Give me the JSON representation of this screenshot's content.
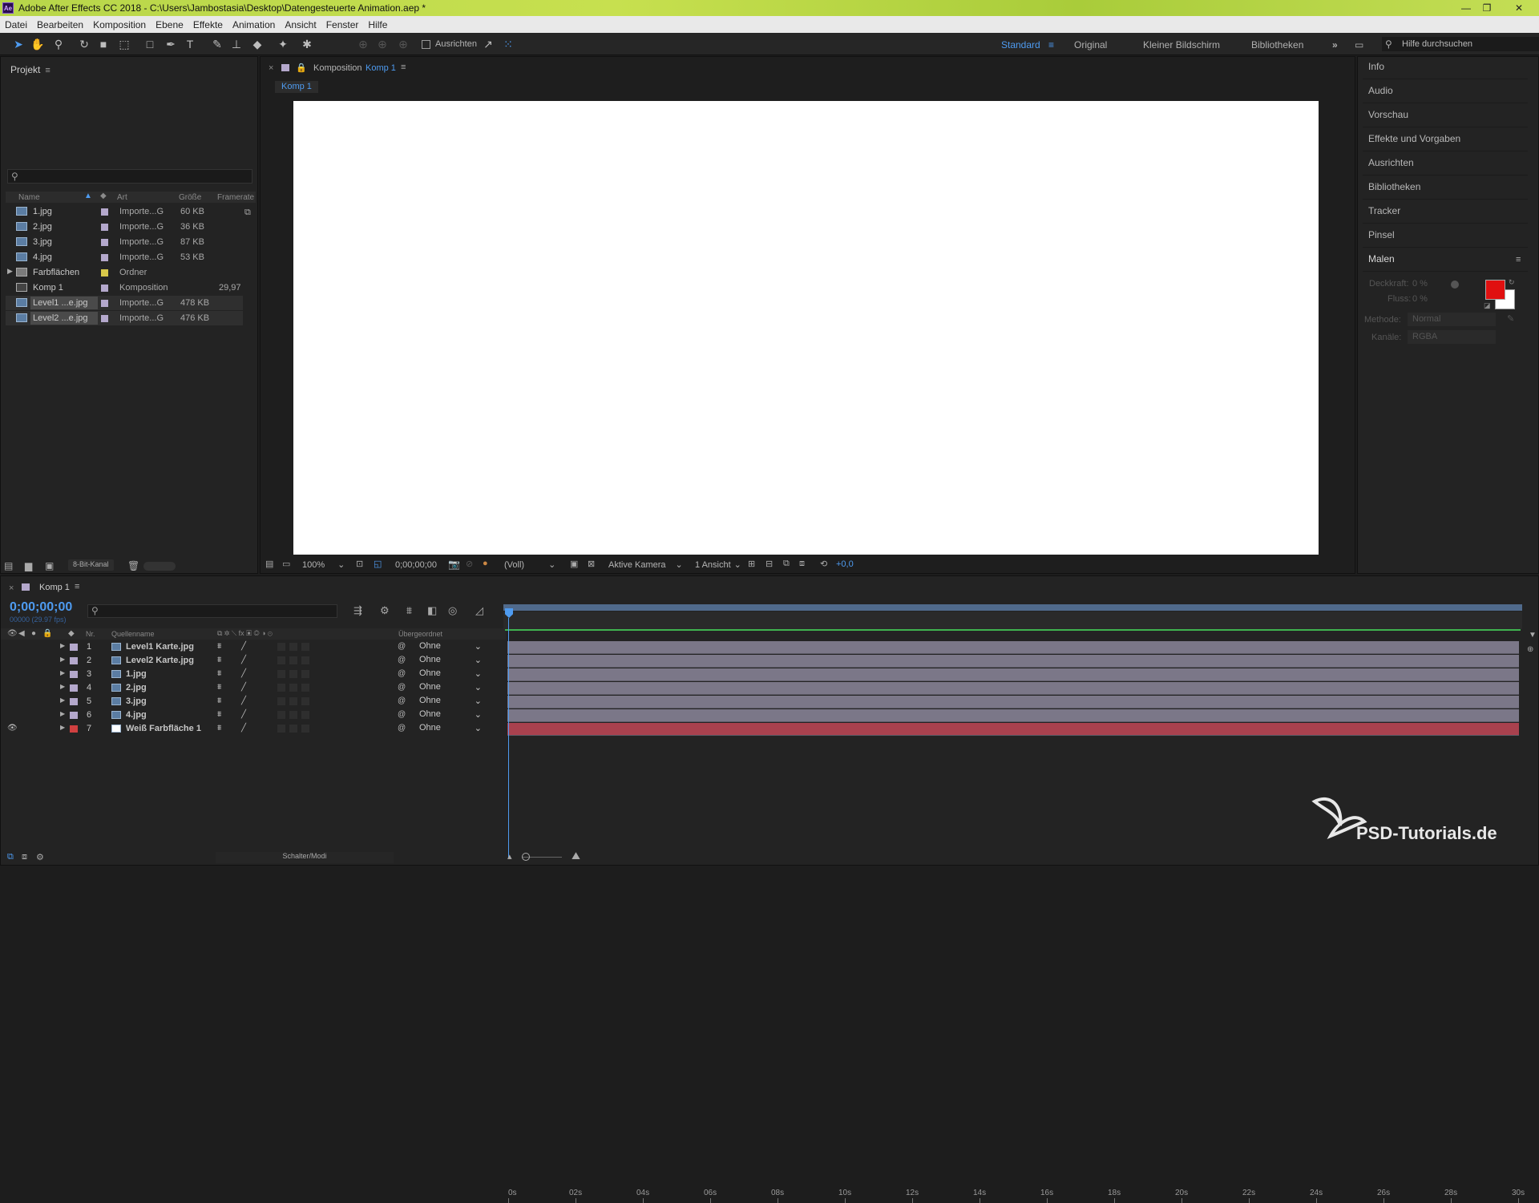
{
  "window": {
    "title": "Adobe After Effects CC 2018 - C:\\Users\\Jambostasia\\Desktop\\Datengesteuerte Animation.aep *",
    "app_icon": "Ae"
  },
  "menu": [
    "Datei",
    "Bearbeiten",
    "Komposition",
    "Ebene",
    "Effekte",
    "Animation",
    "Ansicht",
    "Fenster",
    "Hilfe"
  ],
  "toolbar": {
    "align_label": "Ausrichten",
    "workspaces": [
      "Standard",
      "Original",
      "Kleiner Bildschirm",
      "Bibliotheken"
    ],
    "search_placeholder": "Hilfe durchsuchen"
  },
  "project": {
    "title": "Projekt",
    "columns": {
      "name": "Name",
      "type": "Art",
      "size": "Größe",
      "framerate": "Framerate"
    },
    "items": [
      {
        "name": "1.jpg",
        "type": "Importe...G",
        "size": "60 KB",
        "framerate": "",
        "color": "#b4a8cc",
        "kind": "image"
      },
      {
        "name": "2.jpg",
        "type": "Importe...G",
        "size": "36 KB",
        "framerate": "",
        "color": "#b4a8cc",
        "kind": "image"
      },
      {
        "name": "3.jpg",
        "type": "Importe...G",
        "size": "87 KB",
        "framerate": "",
        "color": "#b4a8cc",
        "kind": "image"
      },
      {
        "name": "4.jpg",
        "type": "Importe...G",
        "size": "53 KB",
        "framerate": "",
        "color": "#b4a8cc",
        "kind": "image"
      },
      {
        "name": "Farbflächen",
        "type": "Ordner",
        "size": "",
        "framerate": "",
        "color": "#d8c84a",
        "kind": "folder"
      },
      {
        "name": "Komp 1",
        "type": "Komposition",
        "size": "",
        "framerate": "29,97",
        "color": "#b4a8cc",
        "kind": "comp"
      },
      {
        "name": "Level1 ...e.jpg",
        "type": "Importe...G",
        "size": "478 KB",
        "framerate": "",
        "color": "#b4a8cc",
        "kind": "image"
      },
      {
        "name": "Level2 ...e.jpg",
        "type": "Importe...G",
        "size": "476 KB",
        "framerate": "",
        "color": "#b4a8cc",
        "kind": "image"
      }
    ],
    "bit_depth": "8-Bit-Kanal"
  },
  "composition": {
    "panel_label": "Komposition",
    "comp_name": "Komp 1",
    "tab": "Komp 1",
    "zoom": "100%",
    "timecode": "0;00;00;00",
    "resolution": "(Voll)",
    "camera": "Aktive Kamera",
    "views": "1 Ansicht",
    "exposure": "+0,0"
  },
  "right_panels": [
    "Info",
    "Audio",
    "Vorschau",
    "Effekte und Vorgaben",
    "Ausrichten",
    "Bibliotheken",
    "Tracker",
    "Pinsel",
    "Malen"
  ],
  "paint": {
    "opacity_label": "Deckkraft:",
    "opacity_value": "0 %",
    "flow_label": "Fluss:",
    "flow_value": "0 %",
    "mode_label": "Methode:",
    "mode_value": "Normal",
    "channels_label": "Kanäle:",
    "channels_value": "RGBA",
    "fg_color": "#e01010",
    "bg_color": "#ffffff"
  },
  "timeline": {
    "tab": "Komp 1",
    "timecode": "0;00;00;00",
    "fps": "00000 (29.97 fps)",
    "columns": {
      "nr": "Nr.",
      "source": "Quellenname",
      "parent": "Übergeordnet"
    },
    "layers": [
      {
        "nr": "1",
        "name": "Level1 Karte.jpg",
        "parent": "Ohne",
        "color": "#b4a8cc",
        "bar": "#7b7788"
      },
      {
        "nr": "2",
        "name": "Level2 Karte.jpg",
        "parent": "Ohne",
        "color": "#b4a8cc",
        "bar": "#7b7788"
      },
      {
        "nr": "3",
        "name": "1.jpg",
        "parent": "Ohne",
        "color": "#b4a8cc",
        "bar": "#7b7788"
      },
      {
        "nr": "4",
        "name": "2.jpg",
        "parent": "Ohne",
        "color": "#b4a8cc",
        "bar": "#7b7788"
      },
      {
        "nr": "5",
        "name": "3.jpg",
        "parent": "Ohne",
        "color": "#b4a8cc",
        "bar": "#7b7788"
      },
      {
        "nr": "6",
        "name": "4.jpg",
        "parent": "Ohne",
        "color": "#b4a8cc",
        "bar": "#7b7788"
      },
      {
        "nr": "7",
        "name": "Weiß Farbfläche 1",
        "parent": "Ohne",
        "color": "#d04040",
        "bar": "#a9414e"
      }
    ],
    "ruler": [
      "0s",
      "02s",
      "04s",
      "06s",
      "08s",
      "10s",
      "12s",
      "14s",
      "16s",
      "18s",
      "20s",
      "22s",
      "24s",
      "26s",
      "28s",
      "30s"
    ],
    "footer_label": "Schalter/Modi"
  },
  "watermark": "PSD-Tutorials.de"
}
